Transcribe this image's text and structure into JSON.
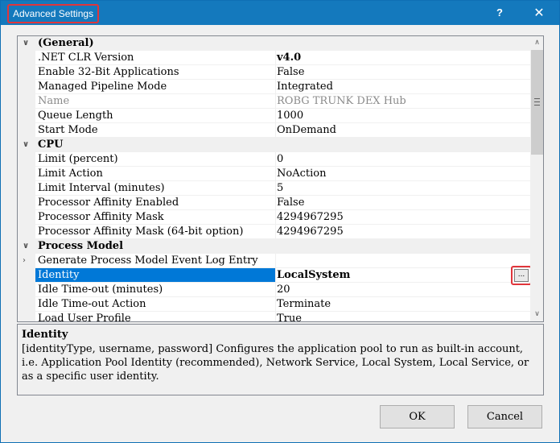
{
  "window": {
    "title": "Advanced Settings",
    "help_label": "?",
    "close_label": "✕"
  },
  "grid": {
    "rows": [
      {
        "type": "category",
        "label": "(General)"
      },
      {
        "type": "prop",
        "name": ".NET CLR Version",
        "value": "v4.0"
      },
      {
        "type": "prop",
        "name": "Enable 32-Bit Applications",
        "value": "False"
      },
      {
        "type": "prop",
        "name": "Managed Pipeline Mode",
        "value": "Integrated"
      },
      {
        "type": "prop",
        "name": "Name",
        "value": "ROBG TRUNK DEX Hub"
      },
      {
        "type": "prop",
        "name": "Queue Length",
        "value": "1000"
      },
      {
        "type": "prop",
        "name": "Start Mode",
        "value": "OnDemand"
      },
      {
        "type": "category",
        "label": "CPU"
      },
      {
        "type": "prop",
        "name": "Limit (percent)",
        "value": "0"
      },
      {
        "type": "prop",
        "name": "Limit Action",
        "value": "NoAction"
      },
      {
        "type": "prop",
        "name": "Limit Interval (minutes)",
        "value": "5"
      },
      {
        "type": "prop",
        "name": "Processor Affinity Enabled",
        "value": "False"
      },
      {
        "type": "prop",
        "name": "Processor Affinity Mask",
        "value": "4294967295"
      },
      {
        "type": "prop",
        "name": "Processor Affinity Mask (64-bit option)",
        "value": "4294967295"
      },
      {
        "type": "category",
        "label": "Process Model"
      },
      {
        "type": "prop",
        "name": "Generate Process Model Event Log Entry",
        "value": ""
      },
      {
        "type": "prop",
        "name": "Identity",
        "value": "LocalSystem"
      },
      {
        "type": "prop",
        "name": "Idle Time-out (minutes)",
        "value": "20"
      },
      {
        "type": "prop",
        "name": "Idle Time-out Action",
        "value": "Terminate"
      },
      {
        "type": "prop",
        "name": "Load User Profile",
        "value": "True"
      }
    ],
    "ellipsis_label": "..."
  },
  "description": {
    "title": "Identity",
    "text": "[identityType, username, password] Configures the application pool to run as built-in account, i.e. Application Pool Identity (recommended), Network Service, Local System, Local Service, or as a specific user identity."
  },
  "buttons": {
    "ok": "OK",
    "cancel": "Cancel"
  }
}
